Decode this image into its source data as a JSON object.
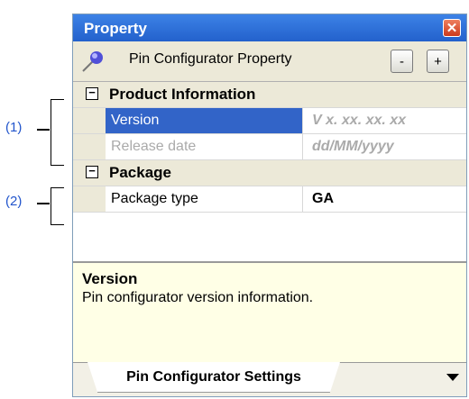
{
  "callouts": {
    "one": "(1)",
    "two": "(2)"
  },
  "panel": {
    "title": "Property",
    "close_icon": "close-icon",
    "toolbar": {
      "label": "Pin Configurator Property",
      "collapse_label": "-",
      "expand_label": "+"
    },
    "categories": [
      {
        "toggle": "⊟",
        "label": "Product Information",
        "rows": [
          {
            "name": "Version",
            "value": "V x. xx. xx. xx",
            "selected": true
          },
          {
            "name": "Release date",
            "value": "dd/MM/yyyy",
            "selected": false
          }
        ]
      },
      {
        "toggle": "⊟",
        "label": "Package",
        "rows": [
          {
            "name": "Package type",
            "value": "GA",
            "selected": false
          }
        ]
      }
    ],
    "description": {
      "heading": "Version",
      "body": "Pin configurator version information."
    },
    "tabs": [
      {
        "label": "Pin Configurator Settings"
      }
    ]
  },
  "colors": {
    "title_bar": "#2a6ad8",
    "selection": "#3264c8",
    "description_bg": "#ffffe6",
    "callout": "#2255cc"
  }
}
